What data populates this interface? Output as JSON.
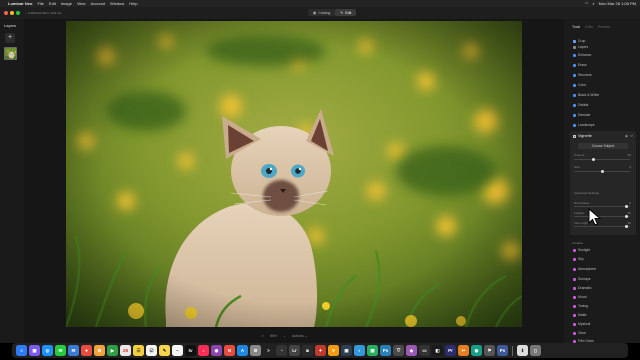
{
  "menubar": {
    "app_name": "Luminar Neo",
    "items": [
      "File",
      "Edit",
      "Image",
      "View",
      "Account",
      "Window",
      "Help"
    ],
    "datetime": "Mon Mar 28 1:08 PM"
  },
  "titlebar": {
    "nav": "‹ LUMINAR NEO / Edit cat",
    "toggle": [
      {
        "label": "Catalog"
      },
      {
        "label": "Edit"
      }
    ]
  },
  "layers": {
    "title": "Layers",
    "add_label": "+"
  },
  "bottombar": {
    "items": [
      "◐",
      "66%",
      "⌄",
      "Actions ⌄"
    ]
  },
  "tools_panel": {
    "tabs": [
      "Tools",
      "Edits",
      "Presets"
    ],
    "active_tab": "Tools",
    "top_items": [
      "Crop",
      "Layers",
      "Enhance",
      "Erase",
      "Structure",
      "Color",
      "Black & White",
      "Details",
      "Denoise",
      "Landscape"
    ],
    "vignette": {
      "title": "Vignette",
      "choose_subject": "Choose Subject",
      "sliders": [
        {
          "label": "Amount",
          "value": "-30",
          "pos": 0.35
        },
        {
          "label": "Size",
          "value": "0",
          "pos": 0.5
        }
      ],
      "advanced_label": "Advanced Settings",
      "advanced_sliders": [
        {
          "label": "Roundness",
          "value": "0",
          "pos": 0.93
        },
        {
          "label": "Feather",
          "value": "50",
          "pos": 0.93
        },
        {
          "label": "Inner Light",
          "value": "30",
          "pos": 0.93
        }
      ]
    },
    "creative_header": "Creative",
    "creative_items": [
      "Sunlight",
      "Sky",
      "Atmosphere",
      "Sunrays",
      "Dramatic",
      "Mood",
      "Toning",
      "Matte",
      "Mystical",
      "Glow",
      "Film Grain"
    ]
  },
  "colors": {
    "accent": "#9b6df0",
    "panel": "#1b1b1b",
    "canvas": "#161616"
  }
}
